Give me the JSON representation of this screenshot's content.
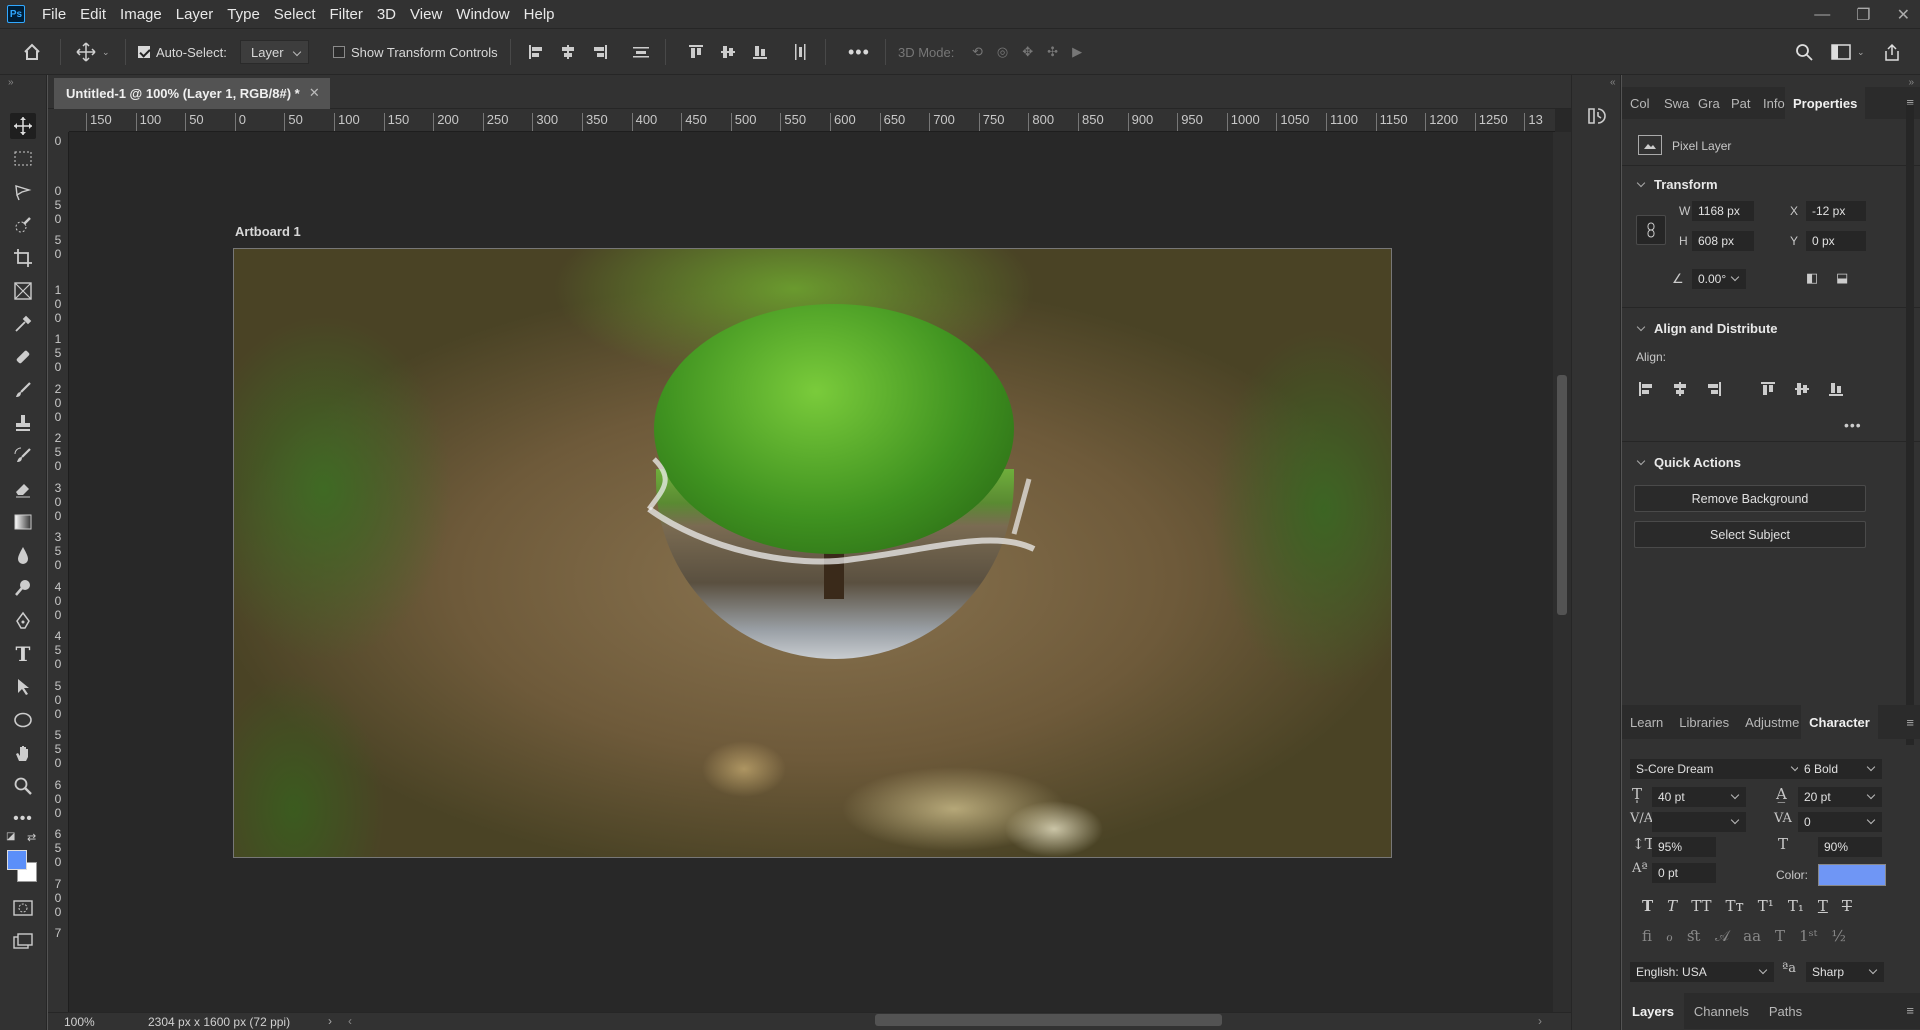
{
  "menubar": {
    "app_icon": "Ps",
    "items": [
      "File",
      "Edit",
      "Image",
      "Layer",
      "Type",
      "Select",
      "Filter",
      "3D",
      "View",
      "Window",
      "Help"
    ]
  },
  "options_bar": {
    "auto_select_label": "Auto-Select:",
    "auto_select_checked": true,
    "auto_select_target": "Layer",
    "show_transform_controls_label": "Show Transform Controls",
    "show_transform_checked": false,
    "mode_3d_label": "3D Mode:"
  },
  "document": {
    "tab_title": "Untitled-1 @ 100% (Layer 1, RGB/8#) *",
    "artboard_label": "Artboard 1",
    "h_ruler_ticks": [
      "150",
      "100",
      "50",
      "0",
      "50",
      "100",
      "150",
      "200",
      "250",
      "300",
      "350",
      "400",
      "450",
      "500",
      "550",
      "600",
      "650",
      "700",
      "750",
      "800",
      "850",
      "900",
      "950",
      "1000",
      "1050",
      "1100",
      "1150",
      "1200",
      "1250",
      "13"
    ],
    "v_ruler_ticks": [
      "0",
      "0 5 0",
      "5 0",
      "1 0 0",
      "1 5 0",
      "2 0 0",
      "2 5 0",
      "3 0 0",
      "3 5 0",
      "4 0 0",
      "4 5 0",
      "5 0 0",
      "5 5 0",
      "6 0 0",
      "6 5 0",
      "7 0 0",
      "7"
    ],
    "zoom": "100%",
    "doc_size": "2304 px x 1600 px (72 ppi)"
  },
  "properties_panel": {
    "tabs": [
      "Col",
      "Swa",
      "Gra",
      "Pat",
      "Info",
      "Properties"
    ],
    "active_tab": "Properties",
    "layer_kind": "Pixel Layer",
    "transform": {
      "title": "Transform",
      "w_label": "W",
      "w_value": "1168 px",
      "h_label": "H",
      "h_value": "608 px",
      "x_label": "X",
      "x_value": "-12 px",
      "y_label": "Y",
      "y_value": "0 px",
      "angle_value": "0.00°"
    },
    "align": {
      "title": "Align and Distribute",
      "align_label": "Align:"
    },
    "quick_actions": {
      "title": "Quick Actions",
      "remove_background": "Remove Background",
      "select_subject": "Select Subject"
    }
  },
  "character_panel": {
    "tabs": [
      "Learn",
      "Libraries",
      "Adjustme",
      "Character"
    ],
    "active_tab": "Character",
    "font_family": "S-Core Dream",
    "font_style": "6 Bold",
    "font_size": "40 pt",
    "leading": "20 pt",
    "kerning": "",
    "tracking": "0",
    "vertical_scale": "95%",
    "horizontal_scale": "90%",
    "baseline_shift": "0 pt",
    "color_label": "Color:",
    "color_value": "#6f96f5",
    "language": "English: USA",
    "aa_label": "a",
    "antialias": "Sharp"
  },
  "layers_panel": {
    "tabs": [
      "Layers",
      "Channels",
      "Paths"
    ],
    "active_tab": "Layers"
  },
  "colors": {
    "foreground": "#5b8ff9",
    "background": "#ffffff"
  }
}
